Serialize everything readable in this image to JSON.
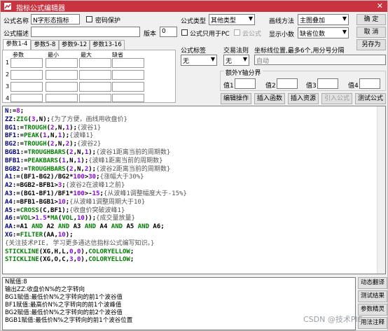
{
  "window": {
    "title": "指标公式编辑器",
    "close_glyph": "✕"
  },
  "form": {
    "name_label": "公式名称",
    "name_value": "N字形态指标",
    "password_label": "密码保护",
    "desc_label": "公式描述",
    "desc_value": "",
    "version_label": "版本",
    "version_value": "0",
    "type_label": "公式类型",
    "type_value": "其他类型",
    "draw_label": "画线方法",
    "draw_value": "主图叠加",
    "only_pc_label": "公式只用于PC",
    "cloud_label": "云公式",
    "decimal_label": "显示小数",
    "decimal_value": "缺省位数",
    "tag_label": "公式标签",
    "tag_value": "无",
    "trade_label": "交易法则",
    "trade_value": "无",
    "coord_label": "坐标线位置,最多6个,用分号分隔",
    "coord_value": "自动",
    "extra_y_label": "额外Y轴分界",
    "val_labels": [
      "值1",
      "值2",
      "值3",
      "值4"
    ]
  },
  "buttons": {
    "ok": "确 定",
    "cancel": "取 消",
    "save_as": "另存为",
    "edit_op": "编辑操作",
    "insert_func": "插入函数",
    "insert_res": "插入资源",
    "import_formula": "引入公式",
    "test_formula": "测试公式"
  },
  "tabs": [
    "参数1-4",
    "参数5-8",
    "参数9-12",
    "参数13-16"
  ],
  "param_headers": [
    "参数",
    "最小",
    "最大",
    "缺省"
  ],
  "param_rows": [
    "1",
    "2",
    "3",
    "4"
  ],
  "code_lines": [
    [
      [
        "kw",
        "N"
      ],
      [
        "op",
        ":="
      ],
      [
        "num",
        "8"
      ],
      [
        "op",
        ";"
      ]
    ],
    [
      [
        "kw",
        "ZZ"
      ],
      [
        "op",
        ":"
      ],
      [
        "fn",
        "ZIG"
      ],
      [
        "op",
        "("
      ],
      [
        "num",
        "3"
      ],
      [
        "op",
        ",N);"
      ],
      [
        "cm",
        "{为了方便，画线用收盘价}"
      ]
    ],
    [
      [
        "kw",
        "BG1"
      ],
      [
        "op",
        ":="
      ],
      [
        "fn",
        "TROUGH"
      ],
      [
        "op",
        "("
      ],
      [
        "num",
        "2"
      ],
      [
        "op",
        ",N,"
      ],
      [
        "num",
        "1"
      ],
      [
        "op",
        ");"
      ],
      [
        "cm",
        "{波谷1}"
      ]
    ],
    [
      [
        "kw",
        "BF1"
      ],
      [
        "op",
        ":="
      ],
      [
        "fn",
        "PEAK"
      ],
      [
        "op",
        "("
      ],
      [
        "num",
        "1"
      ],
      [
        "op",
        ",N,"
      ],
      [
        "num",
        "1"
      ],
      [
        "op",
        ");"
      ],
      [
        "cm",
        "{波峰1}"
      ]
    ],
    [
      [
        "kw",
        "BG2"
      ],
      [
        "op",
        ":="
      ],
      [
        "fn",
        "TROUGH"
      ],
      [
        "op",
        "("
      ],
      [
        "num",
        "2"
      ],
      [
        "op",
        ",N,"
      ],
      [
        "num",
        "2"
      ],
      [
        "op",
        ");"
      ],
      [
        "cm",
        "{波谷2}"
      ]
    ],
    [
      [
        "kw",
        "BGB1"
      ],
      [
        "op",
        ":="
      ],
      [
        "fn",
        "TROUGHBARS"
      ],
      [
        "op",
        "("
      ],
      [
        "num",
        "2"
      ],
      [
        "op",
        ",N,"
      ],
      [
        "num",
        "1"
      ],
      [
        "op",
        ");"
      ],
      [
        "cm",
        "{波谷1距离当前的周期数}"
      ]
    ],
    [
      [
        "kw",
        "BFB1"
      ],
      [
        "op",
        ":="
      ],
      [
        "fn",
        "PEAKBARS"
      ],
      [
        "op",
        "("
      ],
      [
        "num",
        "1"
      ],
      [
        "op",
        ",N,"
      ],
      [
        "num",
        "1"
      ],
      [
        "op",
        ");"
      ],
      [
        "cm",
        "{波峰1距离当前的周期数}"
      ]
    ],
    [
      [
        "kw",
        "BGB2"
      ],
      [
        "op",
        ":="
      ],
      [
        "fn",
        "TROUGHBARS"
      ],
      [
        "op",
        "("
      ],
      [
        "num",
        "2"
      ],
      [
        "op",
        ",N,"
      ],
      [
        "num",
        "2"
      ],
      [
        "op",
        ");"
      ],
      [
        "cm",
        "{波谷2距离当前的周期数}"
      ]
    ],
    [
      [
        "kw",
        "A1"
      ],
      [
        "op",
        ":=(BF1-BG2)/BG2*"
      ],
      [
        "num",
        "100"
      ],
      [
        "op",
        ">"
      ],
      [
        "num",
        "30"
      ],
      [
        "op",
        ";"
      ],
      [
        "cm",
        "{涨幅大于30%}"
      ]
    ],
    [
      [
        "kw",
        "A2"
      ],
      [
        "op",
        ":=BGB2-BFB1>"
      ],
      [
        "num",
        "3"
      ],
      [
        "op",
        ";"
      ],
      [
        "cm",
        "{波谷2在波峰1之前}"
      ]
    ],
    [
      [
        "kw",
        "A3"
      ],
      [
        "op",
        ":=(BG1-BF1)/BF1*"
      ],
      [
        "num",
        "100"
      ],
      [
        "op",
        ">-"
      ],
      [
        "num",
        "15"
      ],
      [
        "op",
        ";"
      ],
      [
        "cm",
        "{从波峰1调整幅度大于-15%}"
      ]
    ],
    [
      [
        "kw",
        "A4"
      ],
      [
        "op",
        ":=BFB1-BGB1>"
      ],
      [
        "num",
        "10"
      ],
      [
        "op",
        ";"
      ],
      [
        "cm",
        "{从波峰1调整周期大于10}"
      ]
    ],
    [
      [
        "kw",
        "A5"
      ],
      [
        "op",
        ":="
      ],
      [
        "fn",
        "CROSS"
      ],
      [
        "op",
        "(C,BF1);"
      ],
      [
        "cm",
        "{收盘价突破波峰1}"
      ]
    ],
    [
      [
        "kw",
        "A6"
      ],
      [
        "op",
        ":="
      ],
      [
        "fn",
        "VOL"
      ],
      [
        "op",
        ">"
      ],
      [
        "num",
        "1.5"
      ],
      [
        "op",
        "*"
      ],
      [
        "fn",
        "MA"
      ],
      [
        "op",
        "("
      ],
      [
        "fn",
        "VOL"
      ],
      [
        "op",
        ","
      ],
      [
        "num",
        "10"
      ],
      [
        "op",
        "));"
      ],
      [
        "cm",
        "{成交量放量}"
      ]
    ],
    [
      [
        "kw",
        "AA"
      ],
      [
        "op",
        ":=A1 "
      ],
      [
        "col",
        "AND"
      ],
      [
        "op",
        " A2 "
      ],
      [
        "col",
        "AND"
      ],
      [
        "op",
        " A3 "
      ],
      [
        "col",
        "AND"
      ],
      [
        "op",
        " A4 "
      ],
      [
        "col",
        "AND"
      ],
      [
        "op",
        " A5 "
      ],
      [
        "col",
        "AND"
      ],
      [
        "op",
        " A6;"
      ]
    ],
    [
      [
        "kw",
        "XG"
      ],
      [
        "op",
        ":="
      ],
      [
        "fn",
        "FILTER"
      ],
      [
        "op",
        "(AA,"
      ],
      [
        "num",
        "10"
      ],
      [
        "op",
        ");"
      ]
    ],
    [
      [
        "cm",
        "{关注技术PIE, 学习更多通达信指标公式编写知识。}"
      ]
    ],
    [
      [
        "fn",
        "STICKLINE"
      ],
      [
        "op",
        "(XG,H,L,"
      ],
      [
        "num",
        "0"
      ],
      [
        "op",
        ","
      ],
      [
        "num",
        "0"
      ],
      [
        "op",
        "),"
      ],
      [
        "col",
        "COLORYELLOW"
      ],
      [
        "op",
        ";"
      ]
    ],
    [
      [
        "fn",
        "STICKLINE"
      ],
      [
        "op",
        "(XG,O,C,"
      ],
      [
        "num",
        "3"
      ],
      [
        "op",
        ","
      ],
      [
        "num",
        "0"
      ],
      [
        "op",
        "),"
      ],
      [
        "col",
        "COLORYELLOW"
      ],
      [
        "op",
        ";"
      ]
    ]
  ],
  "info_lines": [
    "N赋值:8",
    "输出ZZ:收盘价N%的之字转向",
    "BG1赋值:最低价N%之字转向的前1个波谷值",
    "BF1赋值:最高价N%之字转向的前1个波峰值",
    "BG2赋值:最低价N%之字转向的前2个波谷值",
    "BGB1赋值:最低价N%之字转向的前1个波谷位置"
  ],
  "side_buttons": [
    "动态翻译",
    "测试结果",
    "参数精灵",
    "用法注释"
  ],
  "watermark": "CSDN @技术PIE",
  "colors": {
    "title_bar": "#c8333f",
    "keyword": "#00008b",
    "function": "#008000",
    "number": "#8b00ff"
  }
}
